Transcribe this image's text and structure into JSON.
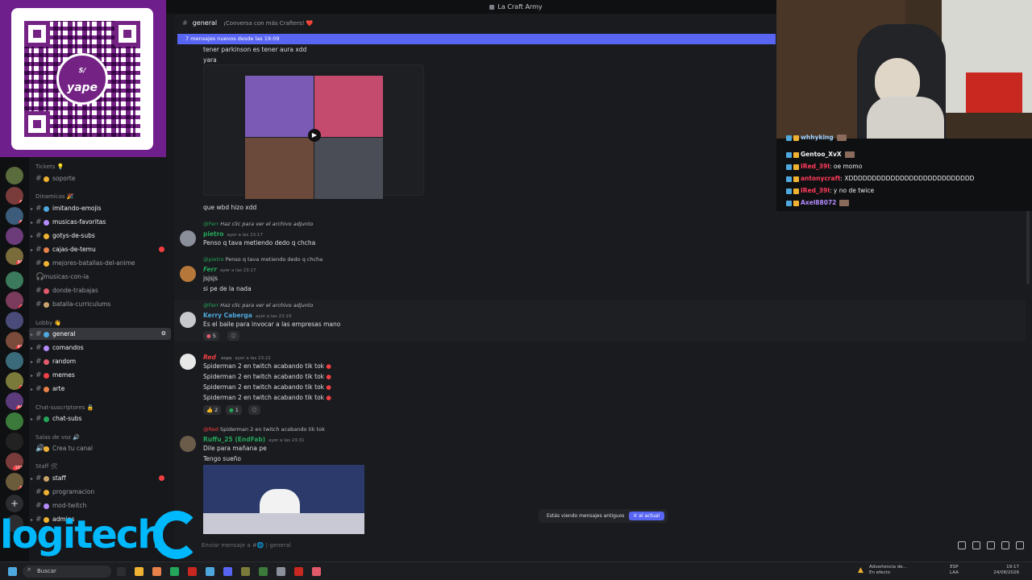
{
  "window": {
    "title": "La Craft Army"
  },
  "channel": {
    "name": "general",
    "topic": "¡Conversa con más Crafters! ❤️"
  },
  "new_messages_bar": "7 mensajes nuevos desde las 19:09",
  "categories": {
    "tickets": "Tickets 💡",
    "dinamicas": "Dinamicas 🎉",
    "lobby": "Lobby 👋",
    "chat_suscriptores": "Chat-suscriptores 🔒",
    "salas_de_voz": "Salas de voz 🔊",
    "staff": "Staff 🛠"
  },
  "channels": {
    "soporte": "soporte",
    "imitando_emojis": "imitando-emojis",
    "musicas_favoritas": "musicas-favoritas",
    "gotys": "gotys-de-subs",
    "cajas": "cajas-de-temu",
    "batallas": "mejores-batallas-del-anime",
    "musicas_ia": "musicas-con-ia",
    "donde_trabajas": "donde-trabajas",
    "batalla_curriculums": "batalla-curriculums",
    "general": "general",
    "comandos": "comandos",
    "random": "random",
    "memes": "memes",
    "arte": "arte",
    "chat_subs": "chat-subs",
    "crea_tu_canal": "Crea tu canal",
    "staff": "staff",
    "programacion": "programacion",
    "mod_twitch": "mod-twitch",
    "admins": "admins"
  },
  "messages": {
    "m0_text": "tener parkinson es tener aura xdd",
    "m0b_text": "yara",
    "m1_text": "que wbd hizo xdd",
    "m2_reply_user": "@Ferr",
    "m2_reply_text": "Haz clic para ver el archivo adjunto",
    "m2_user": "pietro",
    "m2_time": "ayer a las 23:17",
    "m2_text": "Penso q tava metiendo dedo q chcha",
    "m3_reply_user": "@pietro",
    "m3_reply_text": "Penso q tava metiendo dedo q chcha",
    "m3_user": "Ferr",
    "m3_time": "ayer a las 23:17",
    "m3_text": "jsjsjs",
    "m3b_text": "si pe de la nada",
    "m4_reply_user": "@Ferr",
    "m4_reply_text": "Haz clic para ver el archivo adjunto",
    "m4_user": "Kerry Caberga",
    "m4_time": "ayer a las 23:19",
    "m4_text": "Es el baile para invocar a las empresas mano",
    "m4_react_count": "5",
    "m5_user": "Red",
    "m5_tag": "espa",
    "m5_time": "ayer a las 23:22",
    "m5_line": "Spiderman 2 en twitch acabando tik tok",
    "m5_r1": "2",
    "m5_r2": "1",
    "m6_reply_user": "@Red",
    "m6_reply_text": "Spiderman 2 en twitch acabando tik tok",
    "m6_user": "Ruffu_25 (EndFab)",
    "m6_time": "ayer a las 23:31",
    "m6_text": "Dile para mañana pe",
    "m6b_text": "Tengo sueño"
  },
  "jump": {
    "label": "Estás viendo mensajes antiguos",
    "button": "Ir al actual"
  },
  "composer": {
    "placeholder": "Enviar mensaje a #🌐 | general"
  },
  "twitch_chat": [
    {
      "user": "whhyking",
      "text": "",
      "color": "#9ad0ff"
    },
    {
      "user": "Gentoo_XvX",
      "text": "",
      "color": "#f2f2f2"
    },
    {
      "user": "IRed_39I",
      "text": ": oe momo",
      "color": "#ff3b5b"
    },
    {
      "user": "antonycraft",
      "text": ": XDDDDDDDDDDDDDDDDDDDDDDDDDDD",
      "color": "#ff3b5b"
    },
    {
      "user": "IRed_39I",
      "text": ": y no de twice",
      "color": "#ff3b5b"
    },
    {
      "user": "Axel88072",
      "text": "",
      "color": "#b48cff"
    }
  ],
  "qr": {
    "brand": "yape",
    "badge": "S/"
  },
  "overlay": {
    "logo_text": "logitech"
  },
  "taskbar": {
    "search": "Buscar",
    "weather": "Advertencia de...",
    "weather_sub": "En efecto",
    "lang": "ESP",
    "lang_sub": "LAA",
    "time": "19:17",
    "date": "24/08/2026"
  },
  "colors": {
    "accent": "#5865f2",
    "danger": "#f23f43",
    "logitech": "#00b8fc",
    "yape": "#742284"
  }
}
